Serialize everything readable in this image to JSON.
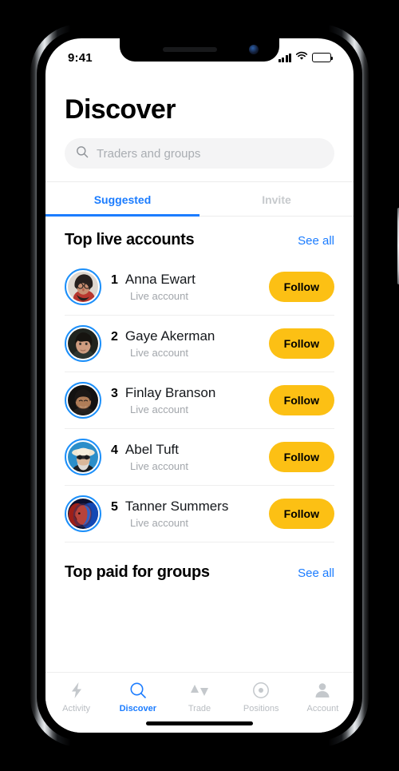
{
  "status_bar": {
    "time": "9:41",
    "signal_icon": "cellular-signal-icon",
    "wifi_icon": "wifi-icon",
    "battery_icon": "battery-icon"
  },
  "header": {
    "title": "Discover"
  },
  "search": {
    "placeholder": "Traders and groups",
    "value": "",
    "icon": "search-icon"
  },
  "tabs": [
    {
      "label": "Suggested",
      "active": true
    },
    {
      "label": "Invite",
      "active": false
    }
  ],
  "sections": [
    {
      "title": "Top live accounts",
      "link_label": "See all"
    },
    {
      "title": "Top paid for groups",
      "link_label": "See all"
    }
  ],
  "accounts": [
    {
      "rank": "1",
      "name": "Anna Ewart",
      "subtitle": "Live account",
      "follow_label": "Follow"
    },
    {
      "rank": "2",
      "name": "Gaye Akerman",
      "subtitle": "Live account",
      "follow_label": "Follow"
    },
    {
      "rank": "3",
      "name": "Finlay Branson",
      "subtitle": "Live account",
      "follow_label": "Follow"
    },
    {
      "rank": "4",
      "name": "Abel Tuft",
      "subtitle": "Live account",
      "follow_label": "Follow"
    },
    {
      "rank": "5",
      "name": "Tanner Summers",
      "subtitle": "Live account",
      "follow_label": "Follow"
    }
  ],
  "tab_bar": [
    {
      "label": "Activity",
      "icon": "lightning-bolt-icon",
      "active": false
    },
    {
      "label": "Discover",
      "icon": "search-icon",
      "active": true
    },
    {
      "label": "Trade",
      "icon": "up-down-triangles-icon",
      "active": false
    },
    {
      "label": "Positions",
      "icon": "target-circle-icon",
      "active": false
    },
    {
      "label": "Account",
      "icon": "person-icon",
      "active": false
    }
  ],
  "colors": {
    "accent_blue": "#1b7cff",
    "follow_yellow": "#fcc014",
    "avatar_ring": "#1b8ffa",
    "muted_grey": "#b9bdc2",
    "search_bg": "#f4f4f5"
  }
}
